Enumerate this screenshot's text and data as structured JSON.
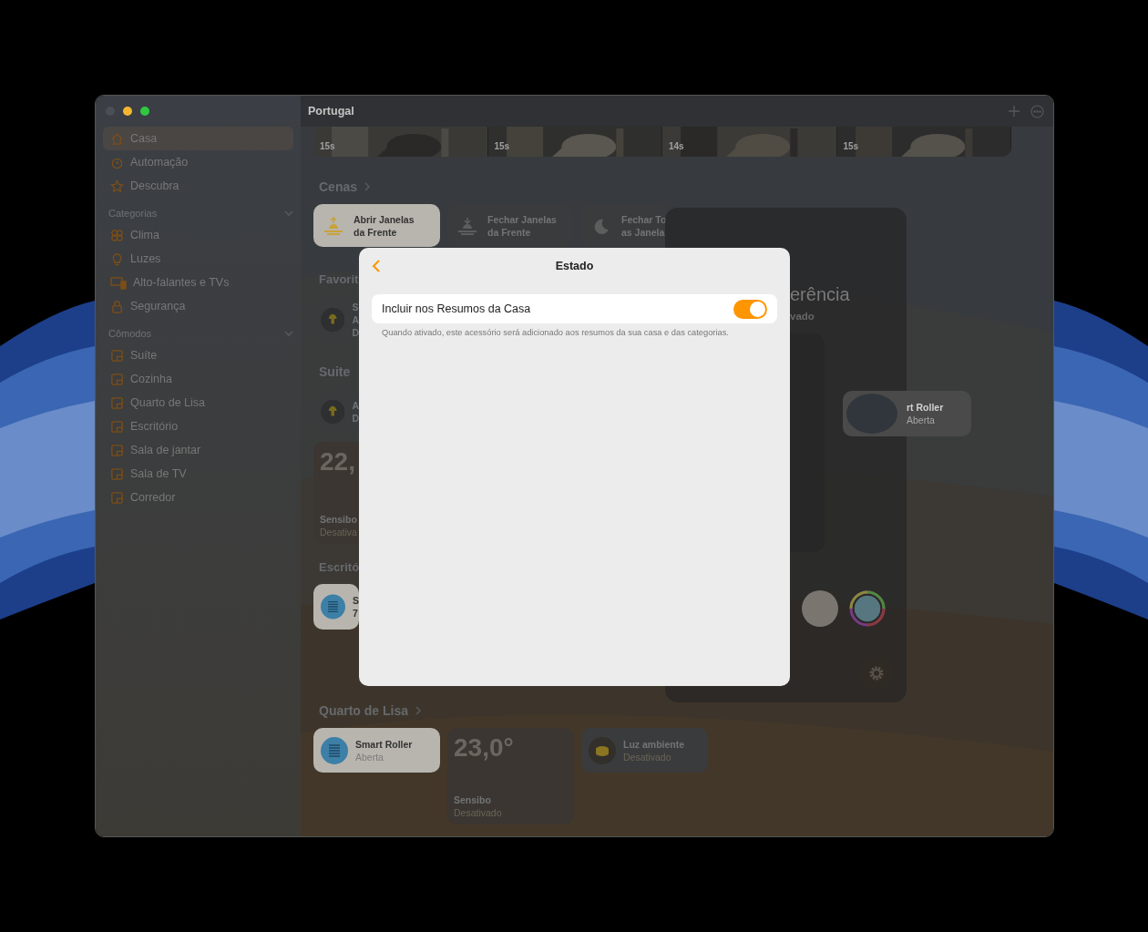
{
  "sidebar": {
    "items": [
      {
        "label": "Casa",
        "selected": true
      },
      {
        "label": "Automação",
        "selected": false
      },
      {
        "label": "Descubra",
        "selected": false
      }
    ],
    "sections": [
      {
        "title": "Categorias",
        "expanded": true,
        "items": [
          {
            "label": "Clima",
            "selected": false
          },
          {
            "label": "Luzes",
            "selected": false
          },
          {
            "label": "Alto-falantes e TVs",
            "selected": false
          },
          {
            "label": "Segurança",
            "selected": false
          }
        ]
      },
      {
        "title": "Cômodos",
        "expanded": true,
        "items": [
          {
            "label": "Suíte",
            "selected": false
          },
          {
            "label": "Cozinha",
            "selected": false
          },
          {
            "label": "Quarto de Lisa",
            "selected": false
          },
          {
            "label": "Escritório",
            "selected": false
          },
          {
            "label": "Sala de jantar",
            "selected": false
          },
          {
            "label": "Sala de TV",
            "selected": false
          },
          {
            "label": "Corredor",
            "selected": false
          }
        ]
      }
    ]
  },
  "toolbar": {
    "title": "Portugal"
  },
  "cameras": [
    {
      "duration": "15s"
    },
    {
      "duration": "15s"
    },
    {
      "duration": "14s"
    },
    {
      "duration": "15s"
    }
  ],
  "scenes": {
    "title": "Cenas",
    "items": [
      {
        "lines": [
          "Abrir Janelas",
          "da Frente"
        ],
        "active": true
      },
      {
        "lines": [
          "Fechar Janelas",
          "da Frente"
        ],
        "active": false
      },
      {
        "lines": [
          "Fechar To",
          "as Janela"
        ],
        "active": false
      }
    ]
  },
  "favorites": {
    "title": "Favorit",
    "tile": {
      "active": false,
      "lines": [
        "S",
        "A",
        "D"
      ]
    }
  },
  "suite": {
    "title": "Suite",
    "tile": {
      "active": false,
      "lines": [
        "A",
        "D"
      ]
    },
    "sensor": {
      "value": "22,",
      "name": "Sensibo",
      "status": "Desativa"
    }
  },
  "office": {
    "title": "Escritó",
    "tile": {
      "active": true,
      "lines": [
        "S",
        "7"
      ]
    }
  },
  "lisa": {
    "title": "Quarto de Lisa",
    "tiles": [
      {
        "kind": "accessory",
        "active": true,
        "name": "Smart Roller",
        "status": "Aberta"
      },
      {
        "kind": "sensor",
        "value": "23,0°",
        "name": "Sensibo",
        "status": "Desativado"
      },
      {
        "kind": "accessory",
        "active": false,
        "name": "Luz ambiente",
        "status": "Desativado"
      }
    ]
  },
  "detail": {
    "title": "erência",
    "status": "vado"
  },
  "popup_tile": {
    "name": "rt Roller",
    "status": "Aberta"
  },
  "modal": {
    "title": "Estado",
    "setting": {
      "label": "Incluir nos Resumos da Casa",
      "on": true
    },
    "footnote": "Quando ativado, este acessório será adicionado aos resumos da sua casa e das categorias."
  }
}
